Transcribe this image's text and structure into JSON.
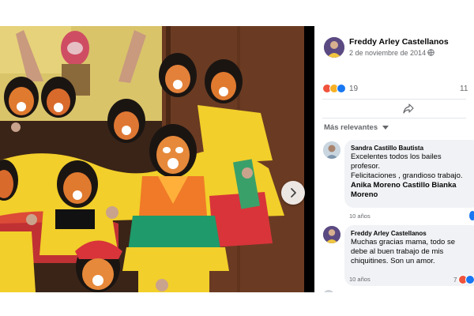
{
  "post": {
    "author": "Freddy Arley Castellanos",
    "date": "2 de noviembre de 2014 · "
  },
  "stats": {
    "reaction_count": "19",
    "comment_count": "11"
  },
  "comments": {
    "sort_label": "Más relevantes",
    "items": [
      {
        "author": "Sandra Castillo Bautista",
        "lines": [
          "Excelentes todos los bailes",
          "profesor.",
          "Felicitaciones , grandioso trabajo."
        ],
        "mentions": [
          "Anika Moreno Castillo Bianka",
          "Moreno"
        ],
        "time": "10 años"
      },
      {
        "author": "Freddy Arley Castellanos",
        "lines": [
          "Muchas gracias mama, todo se",
          "debe al buen trabajo de mis",
          "chiquitines. Son un amor."
        ],
        "time": "10 años",
        "reaction_count": "7"
      }
    ]
  },
  "icons": [
    "globe-icon",
    "angry-reaction",
    "sad-reaction",
    "like-reaction",
    "share-icon",
    "caret-down-icon",
    "chevron-right-icon"
  ],
  "colors": {
    "facebook_blue": "#1877f2",
    "secondary_text": "#65676b",
    "bubble_bg": "#f0f2f5",
    "divider": "#e4e6eb"
  }
}
